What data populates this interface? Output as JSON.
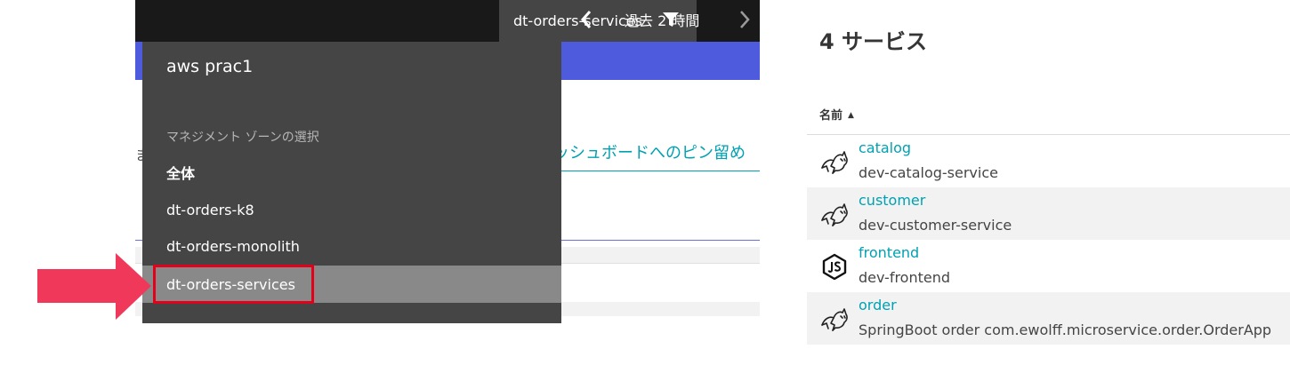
{
  "topbar": {
    "filter_label": "dt-orders-services",
    "time_label": "過去 2 時間"
  },
  "background": {
    "partial_char": "ま",
    "pin_link": "ッシュボードへのピン留め"
  },
  "dropdown": {
    "environment": "aws prac1",
    "heading": "マネジメント ゾーンの選択",
    "items": [
      {
        "label": "全体"
      },
      {
        "label": "dt-orders-k8"
      },
      {
        "label": "dt-orders-monolith"
      },
      {
        "label": "dt-orders-services",
        "selected": true
      }
    ]
  },
  "services": {
    "title": "4 サービス",
    "column_header": "名前",
    "sort_indicator": "▲",
    "rows": [
      {
        "name": "catalog",
        "sub": "dev-catalog-service",
        "icon": "tomcat-icon"
      },
      {
        "name": "customer",
        "sub": "dev-customer-service",
        "icon": "tomcat-icon"
      },
      {
        "name": "frontend",
        "sub": "dev-frontend",
        "icon": "nodejs-icon"
      },
      {
        "name": "order",
        "sub": "SpringBoot order com.ewolff.microservice.order.OrderApp",
        "icon": "tomcat-icon"
      }
    ]
  },
  "colors": {
    "accent_link": "#00a1b2",
    "band_blue": "#4d5bdc",
    "highlight_red": "#e3001b",
    "arrow_pink": "#f0395a"
  }
}
